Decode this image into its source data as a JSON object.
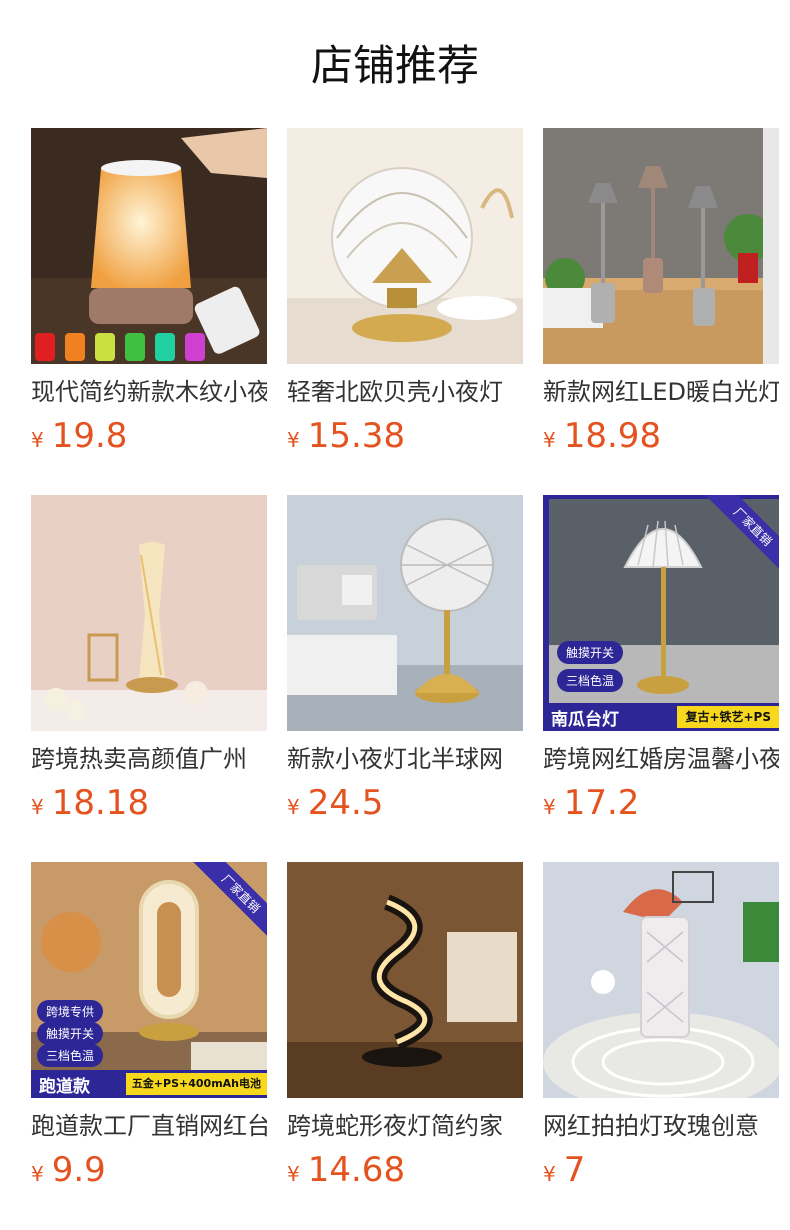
{
  "page_title": "店铺推荐",
  "currency_symbol": "¥",
  "colors": {
    "price": "#e4531f",
    "badge_bg": "#2d2696",
    "badge_yellow": "#f7d81c"
  },
  "products": [
    {
      "name": "现代简约新款木纹小夜灯",
      "price": "19.8"
    },
    {
      "name": "轻奢北欧贝壳小夜灯",
      "price": "15.38"
    },
    {
      "name": "新款网红LED暖白光灯",
      "price": "18.98"
    },
    {
      "name": "跨境热卖高颜值广州",
      "price": "18.18"
    },
    {
      "name": "新款小夜灯北半球网",
      "price": "24.5"
    },
    {
      "name": "跨境网红婚房温馨小夜",
      "price": "17.2",
      "badges": {
        "corner": "厂家直销",
        "pills": [
          "触摸开关",
          "三档色温"
        ],
        "bar_left": "南瓜台灯",
        "bar_right": "复古+铁艺+PS"
      }
    },
    {
      "name": "跑道款工厂直销网红台灯",
      "price": "9.9",
      "badges": {
        "corner": "厂家直销",
        "pills": [
          "跨境专供",
          "触摸开关",
          "三档色温"
        ],
        "bar_left": "跑道款",
        "bar_right": "五金+PS+400mAh电池"
      }
    },
    {
      "name": "跨境蛇形夜灯简约家",
      "price": "14.68"
    },
    {
      "name": "网红拍拍灯玫瑰创意",
      "price": "7"
    }
  ]
}
